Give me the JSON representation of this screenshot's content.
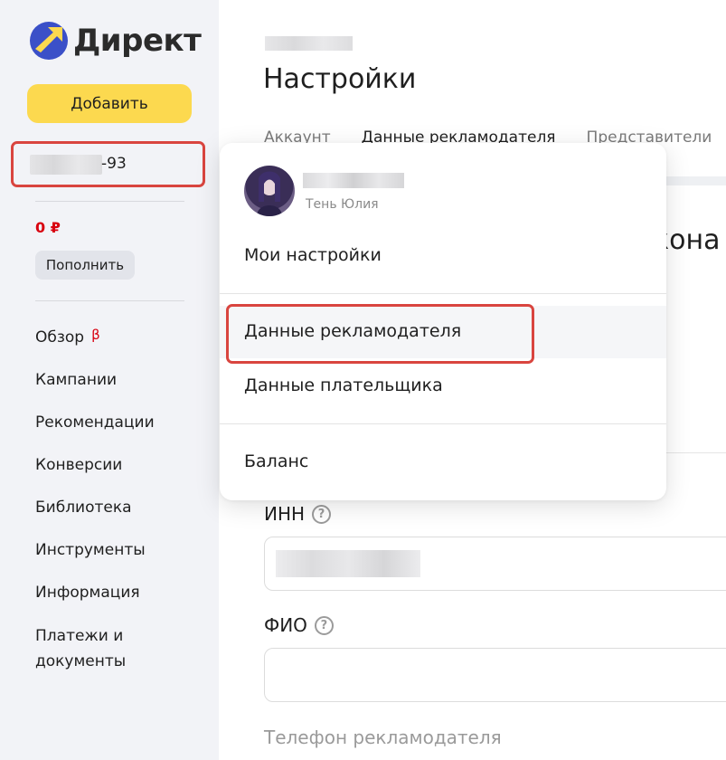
{
  "sidebar": {
    "logo_text": "Директ",
    "add_button": "Добавить",
    "login_suffix": "-93",
    "balance": "0 ₽",
    "topup_button": "Пополнить",
    "nav": [
      {
        "label": "Обзор",
        "badge": "β"
      },
      {
        "label": "Кампании"
      },
      {
        "label": "Рекомендации"
      },
      {
        "label": "Конверсии"
      },
      {
        "label": "Библиотека"
      },
      {
        "label": "Инструменты"
      },
      {
        "label": "Информация"
      },
      {
        "label": "Платежи и документы"
      }
    ]
  },
  "main": {
    "title": "Настройки",
    "tabs": [
      "Аккаунт",
      "Данные рекламодателя",
      "Представители"
    ],
    "section_fragment": "кона",
    "fields": {
      "inn_label": "ИНН",
      "fio_label": "ФИО",
      "phone_label": "Телефон рекламодателя"
    },
    "help_glyph": "?"
  },
  "dropdown": {
    "user_name": "Тень Юлия",
    "items": {
      "my_settings": "Мои настройки",
      "advertiser_data": "Данные рекламодателя",
      "payer_data": "Данные плательщика",
      "balance": "Баланс"
    }
  },
  "colors": {
    "accent_yellow": "#fcd94f",
    "annotation_red": "#d9453f",
    "balance_red": "#d8000f",
    "sidebar_bg": "#f2f3f7"
  },
  "icons": [
    "yandex-direct-logo-icon",
    "help-icon",
    "avatar"
  ]
}
